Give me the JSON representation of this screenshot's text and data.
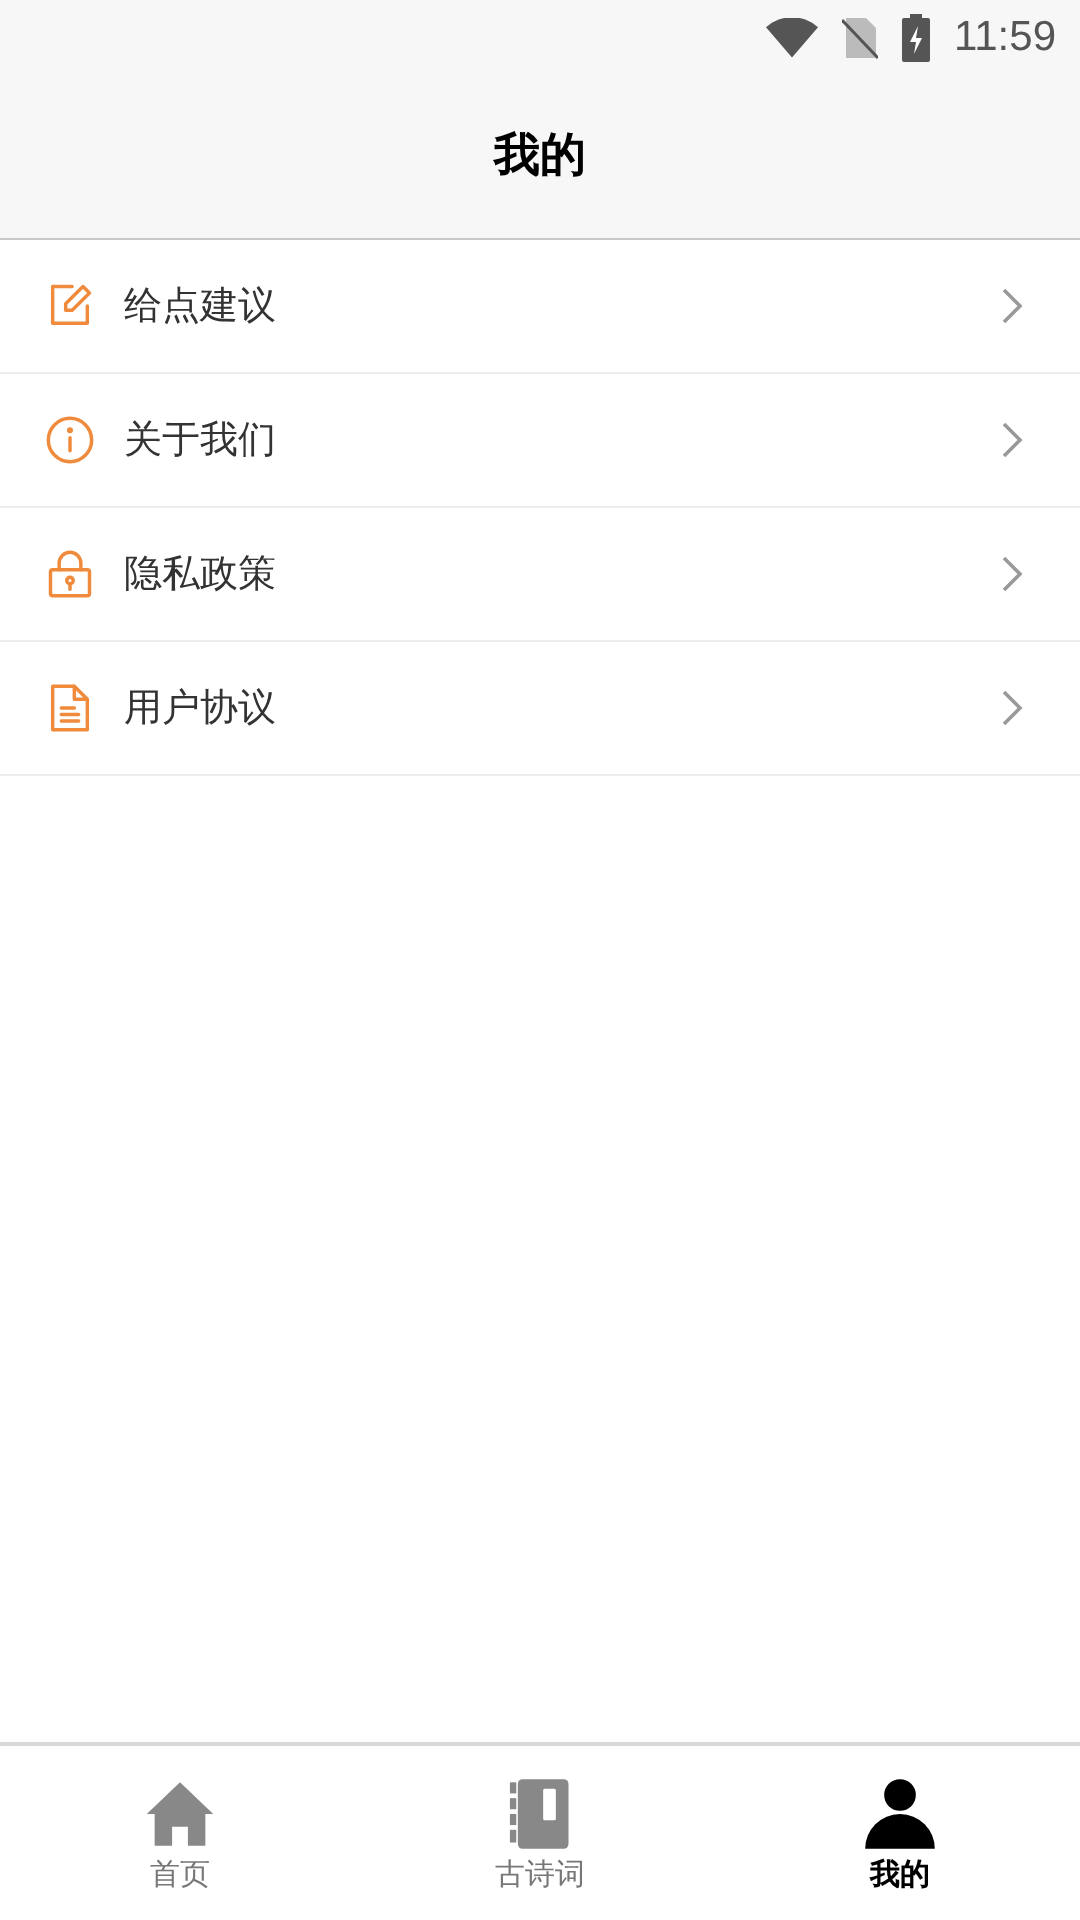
{
  "status_bar": {
    "time": "11:59"
  },
  "header": {
    "title": "我的"
  },
  "menu": [
    {
      "kind": "edit",
      "label": "给点建议"
    },
    {
      "kind": "info",
      "label": "关于我们"
    },
    {
      "kind": "lock",
      "label": "隐私政策"
    },
    {
      "kind": "document",
      "label": "用户协议"
    }
  ],
  "tabs": [
    {
      "kind": "home",
      "label": "首页",
      "selected": false
    },
    {
      "kind": "book",
      "label": "古诗词",
      "selected": false
    },
    {
      "kind": "person",
      "label": "我的",
      "selected": true
    }
  ]
}
